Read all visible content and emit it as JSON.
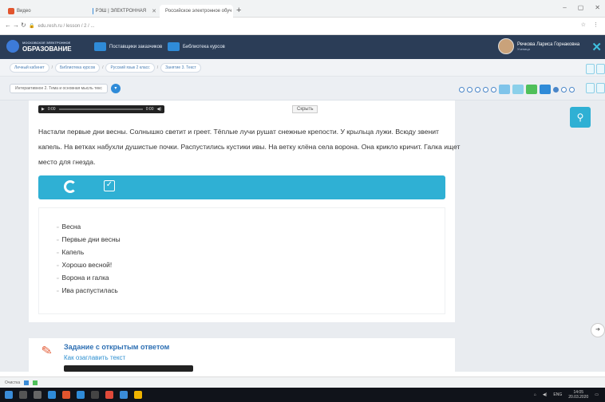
{
  "browser": {
    "tabs": [
      {
        "label": "Видео",
        "color": "#e2552e"
      },
      {
        "label": "РЭШ | ЭЛЕКТРОННАЯ",
        "color": "#3a8cd8"
      },
      {
        "label": "Российское электронное обуч",
        "color": "#2f8bd8"
      }
    ],
    "new_tab": "+",
    "url": "edu.resh.ru / lesson / 2 / ...",
    "window_controls": [
      "–",
      "▢",
      "✕"
    ]
  },
  "site": {
    "logo_title": "ОБРАЗОВАНИЕ",
    "logo_subtitle": "МОСКОВСКОЕ ЭЛЕКТРОННОЕ",
    "nav": [
      {
        "label": "Поставщики заказчиков"
      },
      {
        "label": "Библиотека курсов"
      }
    ],
    "user_name": "Речкова Лариса Горнаковна",
    "user_role": "Ученица",
    "close_glyph": "✕"
  },
  "breadcrumbs": [
    "Личный кабинет",
    "Библиотека курсов",
    "Русский язык 2 класс",
    "Занятие 3. Текст"
  ],
  "lesson": {
    "select_value": "Интерактивное 2. Тема и основная мысль текс",
    "pager_count": 12
  },
  "task": {
    "audio_time_start": "0:00",
    "audio_time_end": "0:00",
    "hide_label": "Скрыть",
    "text": "Настали первые дни весны. Солнышко светит и греет. Тёплые лучи рушат снежные крепости. У крыльца лужи. Всюду звенит капель. На ветках набухли душистые почки. Распустились кустики ивы. На ветку клёна села ворона. Она крикло кричит. Галка ищет место для гнезда.",
    "answers": [
      "Весна",
      "Первые дни весны",
      "Капель",
      "Хорошо весной!",
      "Ворона и галка",
      "Ива распустилась"
    ]
  },
  "task2": {
    "title": "Задание с открытым ответом",
    "subtitle": "Как озаглавить текст"
  },
  "downloads_label": "Очистка",
  "tray": {
    "time": "14:05",
    "date": "20.03.2020",
    "lang": "ENG"
  }
}
